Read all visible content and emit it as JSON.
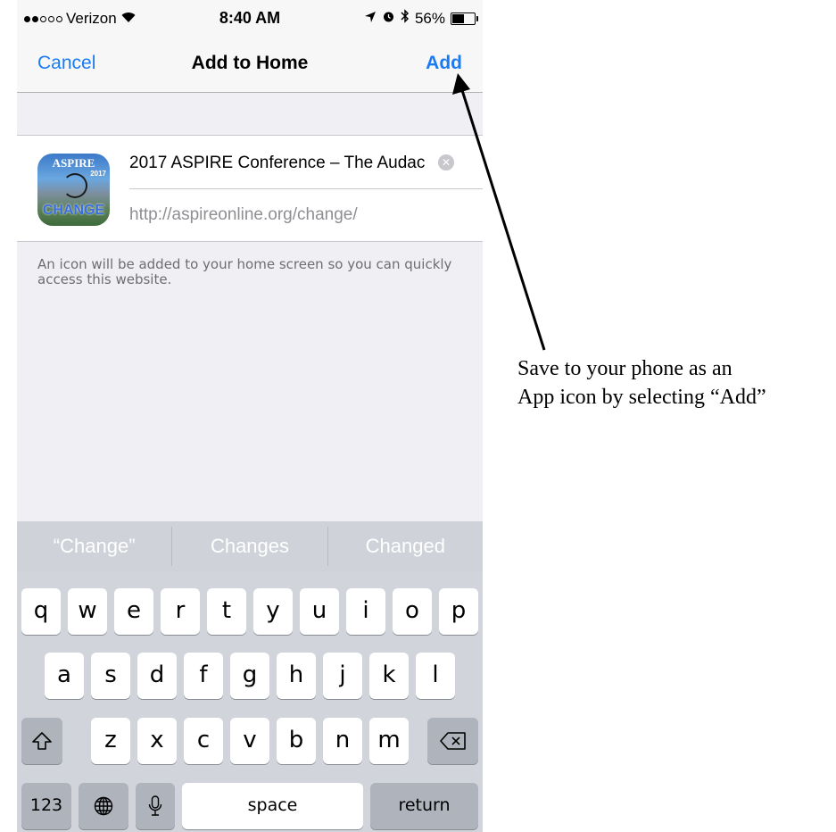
{
  "status_bar": {
    "carrier": "Verizon",
    "time": "8:40 AM",
    "battery": "56%",
    "battery_level": 0.56,
    "icons": [
      "signal-dots-icon",
      "wifi-icon",
      "location-arrow-icon",
      "alarm-icon",
      "bluetooth-icon",
      "battery-icon"
    ]
  },
  "nav": {
    "cancel_label": "Cancel",
    "title": "Add to Home",
    "add_label": "Add",
    "accent_color": "#1a7bf2"
  },
  "bookmark": {
    "icon_name": "aspire-app-icon",
    "title_value": "2017 ASPIRE Conference – The Audac",
    "url_value": "http://aspireonline.org/change/"
  },
  "footnote": "An icon will be added to your home screen so you can quickly access this website.",
  "suggestions": [
    "“Change”",
    "Changes",
    "Changed"
  ],
  "keyboard": {
    "row1": [
      "q",
      "w",
      "e",
      "r",
      "t",
      "y",
      "u",
      "i",
      "o",
      "p"
    ],
    "row2": [
      "a",
      "s",
      "d",
      "f",
      "g",
      "h",
      "j",
      "k",
      "l"
    ],
    "row3": [
      "z",
      "x",
      "c",
      "v",
      "b",
      "n",
      "m"
    ],
    "numbers_label": "123",
    "space_label": "space",
    "return_label": "return"
  },
  "annotation": "Save to your phone as an\nApp icon by selecting “Add”"
}
